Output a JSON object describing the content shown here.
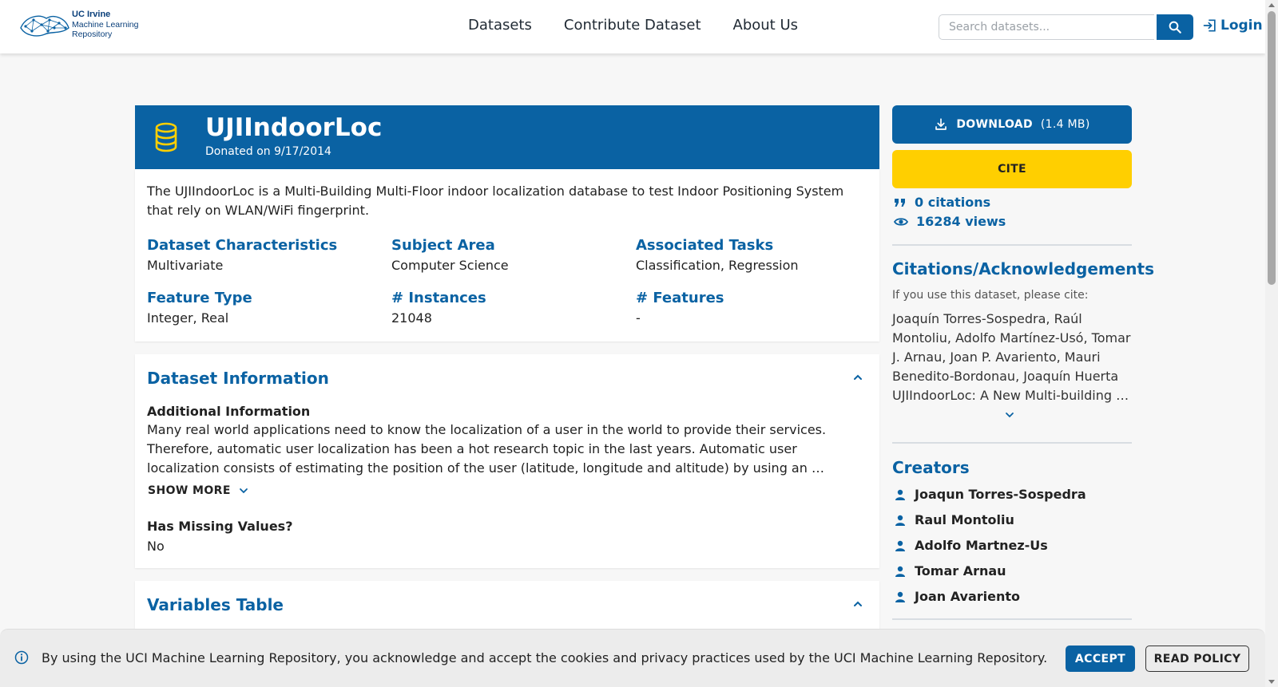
{
  "header": {
    "logo": {
      "line1": "UC Irvine",
      "line2": "Machine Learning",
      "line3": "Repository"
    },
    "nav": [
      "Datasets",
      "Contribute Dataset",
      "About Us"
    ],
    "search_placeholder": "Search datasets...",
    "login_label": "Login"
  },
  "dataset": {
    "title": "UJIIndoorLoc",
    "donated": "Donated on 9/17/2014",
    "description": "The UJIIndoorLoc is a Multi-Building Multi-Floor indoor localization database to test Indoor Positioning System that rely on WLAN/WiFi fingerprint.",
    "facts": [
      {
        "label": "Dataset Characteristics",
        "value": "Multivariate"
      },
      {
        "label": "Subject Area",
        "value": "Computer Science"
      },
      {
        "label": "Associated Tasks",
        "value": "Classification, Regression"
      },
      {
        "label": "Feature Type",
        "value": "Integer, Real"
      },
      {
        "label": "# Instances",
        "value": "21048"
      },
      {
        "label": "# Features",
        "value": "-"
      }
    ]
  },
  "info_section": {
    "title": "Dataset Information",
    "additional_heading": "Additional Information",
    "additional_text": "Many real world applications need to know the localization of a user in the world to provide their services. Therefore, automatic user localization has been a hot research topic in the last years. Automatic user localization consists of estimating the position of the user (latitude, longitude and altitude) by using an …",
    "show_more": "SHOW MORE",
    "missing_heading": "Has Missing Values?",
    "missing_value": "No"
  },
  "variables_section": {
    "title": "Variables Table"
  },
  "sidebar": {
    "download_label": "DOWNLOAD",
    "download_size": "(1.4 MB)",
    "cite_label": "CITE",
    "citations": "0 citations",
    "views": "16284 views",
    "citations_title": "Citations/Acknowledgements",
    "citations_hint": "If you use this dataset, please cite:",
    "citation_text": "Joaquín Torres-Sospedra, Raúl Montoliu, Adolfo Martínez-Usó, Tomar J. Arnau, Joan P. Avariento, Mauri Benedito-Bordonau, Joaquín Huerta UJIIndoorLoc: A New Multi-building …",
    "creators_title": "Creators",
    "creators": [
      "Joaqun Torres-Sospedra",
      "Raul Montoliu",
      "Adolfo Martnez-Us",
      "Tomar Arnau",
      "Joan Avariento"
    ]
  },
  "cookie": {
    "text": "By using the UCI Machine Learning Repository, you acknowledge and accept the cookies and privacy practices used by the UCI Machine Learning Repository.",
    "accept": "ACCEPT",
    "read_policy": "READ POLICY"
  },
  "colors": {
    "primary": "#0a62a3",
    "cite": "#ffcf00"
  }
}
